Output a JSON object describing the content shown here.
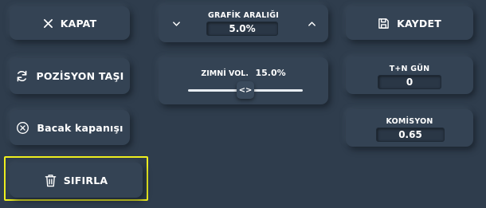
{
  "buttons": {
    "close_label": "KAPAT",
    "move_position_label": "POZİSYON TAŞI",
    "close_leg_label": "Bacak kapanışı",
    "reset_label": "SIFIRLA",
    "save_label": "KAYDET"
  },
  "chart_range": {
    "label": "GRAFİK ARALIĞI",
    "value": "5.0%"
  },
  "implied_vol": {
    "label": "ZIMNİ VOL.",
    "value": "15.0%",
    "slider_level_fraction": 0.5,
    "handle_glyph": "<>"
  },
  "t_n_day": {
    "label": "T+N GÜN",
    "value": "0"
  },
  "commission": {
    "label": "KOMİSYON",
    "value": "0.65"
  },
  "icons": {
    "close": "x-icon",
    "move": "refresh-icon",
    "close_leg": "x-circle-icon",
    "reset": "trash-icon",
    "save": "floppy-disk-icon",
    "decrease": "chevron-down-icon",
    "increase": "chevron-up-icon"
  },
  "colors": {
    "background": "#2f3d4d",
    "panel": "#344354",
    "highlight": "#f0f01e"
  }
}
